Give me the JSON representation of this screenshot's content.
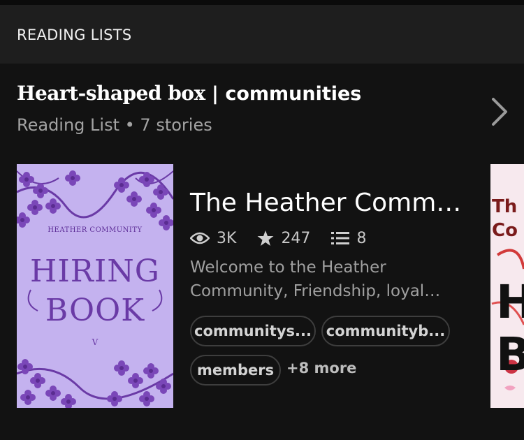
{
  "section": {
    "title": "READING LISTS"
  },
  "reading_list": {
    "title_part1": "Heart-shaped box",
    "title_part2": " | communities",
    "meta": "Reading List • 7 stories"
  },
  "story": {
    "title": "The Heather Comm…",
    "cover": {
      "subtitle": "HEATHER COMMUNITY",
      "line1": "HIRING",
      "line2": "BOOK",
      "mark": "V",
      "bg_color": "#c4b2ef",
      "ink_color": "#6a3aa6"
    },
    "stats": {
      "views": "3K",
      "votes": "247",
      "parts": "8"
    },
    "description_lines": [
      "Welcome to the Heather",
      "Community,  Friendship, loyal…"
    ],
    "tags": [
      "communitys...",
      "communityb...",
      "members"
    ],
    "more_tags": "+8 more"
  },
  "next_story": {
    "cover_text_line1": "Th",
    "cover_text_line2": "Co",
    "big_letter_1": "H",
    "big_letter_2": "B"
  },
  "icons": {
    "views": "eye-icon",
    "votes": "star-icon",
    "parts": "list-icon",
    "open": "chevron-right-icon"
  }
}
